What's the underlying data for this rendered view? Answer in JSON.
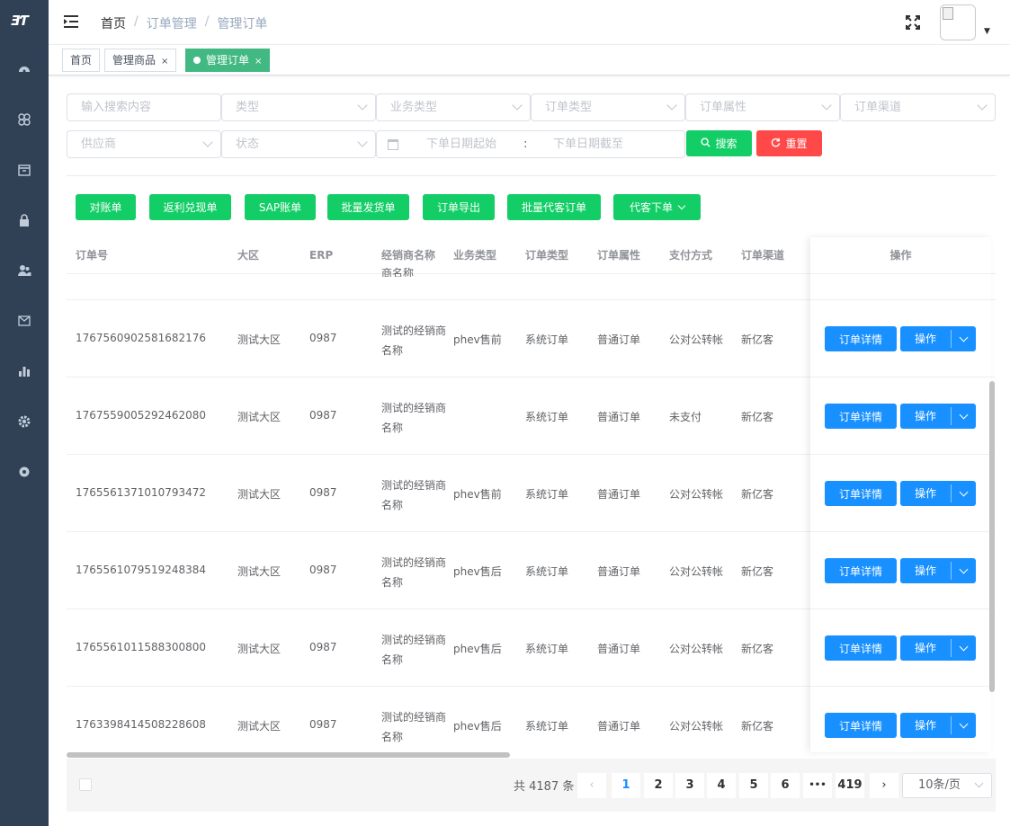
{
  "sidebar": {
    "logo": "ƎƬ",
    "icons": [
      "dashboard-icon",
      "flower-icon",
      "box-icon",
      "lock-icon",
      "users-icon",
      "mail-icon",
      "chart-bar-icon",
      "gear-icon",
      "cog-icon"
    ]
  },
  "header": {
    "breadcrumb": [
      "首页",
      "订单管理",
      "管理订单"
    ]
  },
  "tags": [
    {
      "label": "首页",
      "closable": false
    },
    {
      "label": "管理商品",
      "closable": true
    },
    {
      "label": "管理订单",
      "closable": true,
      "active": true
    }
  ],
  "filters": {
    "search_placeholder": "输入搜索内容",
    "type": "类型",
    "business_type": "业务类型",
    "order_type": "订单类型",
    "order_attr": "订单属性",
    "order_channel": "订单渠道",
    "supplier": "供应商",
    "status": "状态",
    "date_start": "下单日期起始",
    "date_sep": ":",
    "date_end": "下单日期截至",
    "search_btn": "搜索",
    "reset_btn": "重置"
  },
  "actions": [
    "对账单",
    "返利兑现单",
    "SAP账单",
    "批量发货单",
    "订单导出",
    "批量代客订单",
    "代客下单"
  ],
  "table": {
    "headers": [
      "订单号",
      "大区",
      "ERP",
      "经销商名称",
      "业务类型",
      "订单类型",
      "订单属性",
      "支付方式",
      "订单渠道",
      "操作"
    ],
    "cutoff_text": "商名称",
    "rows": [
      {
        "order_no": "1767560902581682176",
        "region": "测试大区",
        "erp": "0987",
        "dealer": "测试的经销商名称",
        "biz": "phev售前",
        "otype": "系统订单",
        "attr": "普通订单",
        "pay": "公对公转帐",
        "channel": "新亿客"
      },
      {
        "order_no": "1767559005292462080",
        "region": "测试大区",
        "erp": "0987",
        "dealer": "测试的经销商名称",
        "biz": "",
        "otype": "系统订单",
        "attr": "普通订单",
        "pay": "未支付",
        "channel": "新亿客"
      },
      {
        "order_no": "1765561371010793472",
        "region": "测试大区",
        "erp": "0987",
        "dealer": "测试的经销商名称",
        "biz": "phev售前",
        "otype": "系统订单",
        "attr": "普通订单",
        "pay": "公对公转帐",
        "channel": "新亿客"
      },
      {
        "order_no": "1765561079519248384",
        "region": "测试大区",
        "erp": "0987",
        "dealer": "测试的经销商名称",
        "biz": "phev售后",
        "otype": "系统订单",
        "attr": "普通订单",
        "pay": "公对公转帐",
        "channel": "新亿客"
      },
      {
        "order_no": "1765561011588300800",
        "region": "测试大区",
        "erp": "0987",
        "dealer": "测试的经销商名称",
        "biz": "phev售后",
        "otype": "系统订单",
        "attr": "普通订单",
        "pay": "公对公转帐",
        "channel": "新亿客"
      },
      {
        "order_no": "1763398414508228608",
        "region": "测试大区",
        "erp": "0987",
        "dealer": "测试的经销商名称",
        "biz": "phev售后",
        "otype": "系统订单",
        "attr": "普通订单",
        "pay": "公对公转帐",
        "channel": "新亿客"
      }
    ],
    "op_detail": "订单详情",
    "op_action": "操作"
  },
  "pagination": {
    "total": "共 4187 条",
    "pages": [
      "1",
      "2",
      "3",
      "4",
      "5",
      "6",
      "•••",
      "419"
    ],
    "current": "1",
    "page_size": "10条/页"
  },
  "colors": {
    "sidebar": "#304156",
    "green": "#13ce66",
    "red": "#ff4949",
    "blue": "#1890ff",
    "tag_active": "#42b983"
  }
}
